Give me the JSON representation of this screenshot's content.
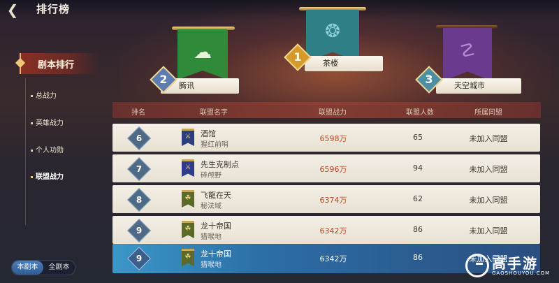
{
  "header": {
    "title": "排行榜",
    "back_icon": "back-arrow-icon"
  },
  "sidebar": {
    "main_label": "剧本排行",
    "items": [
      {
        "label": "总战力",
        "active": false
      },
      {
        "label": "英雄战力",
        "active": false
      },
      {
        "label": "个人功勋",
        "active": false
      },
      {
        "label": "联盟战力",
        "active": true
      }
    ]
  },
  "scope_toggle": {
    "current": "本剧本",
    "all": "全剧本"
  },
  "podium": [
    {
      "rank": "2",
      "name": "腾讯",
      "banner_color": "#2f8a3a",
      "medal_color": "#5b7db2"
    },
    {
      "rank": "1",
      "name": "茶楼",
      "banner_color": "#2f7f86",
      "medal_color": "#d59a2a"
    },
    {
      "rank": "3",
      "name": "天空城市",
      "banner_color": "#6a3a8e",
      "medal_color": "#4f8fa6"
    }
  ],
  "table": {
    "headers": [
      "排名",
      "联盟名字",
      "联盟战力",
      "联盟人数",
      "所属同盟"
    ],
    "rows": [
      {
        "rank": "6",
        "name": "酒馆",
        "leader": "猩红前哨",
        "power": "6598万",
        "members": "65",
        "alliance": "未加入同盟",
        "flag_color": "#2c3f7a"
      },
      {
        "rank": "7",
        "name": "先生克制点",
        "leader": "碎颅野",
        "power": "6596万",
        "members": "94",
        "alliance": "未加入同盟",
        "flag_color": "#2f3a8a"
      },
      {
        "rank": "8",
        "name": "飞龍在天",
        "leader": "秘法域",
        "power": "6374万",
        "members": "62",
        "alliance": "未加入同盟",
        "flag_color": "#5a6a2a"
      },
      {
        "rank": "9",
        "name": "龙十帝国",
        "leader": "猎喉地",
        "power": "6342万",
        "members": "86",
        "alliance": "未加入同盟",
        "flag_color": "#5a6a2a"
      }
    ],
    "self_row": {
      "rank": "9",
      "name": "龙十帝国",
      "leader": "猎喉地",
      "power": "6342万",
      "members": "86",
      "alliance": "未加入同盟",
      "flag_color": "#5a6a2a"
    }
  },
  "watermark": {
    "brand": "高手游",
    "domain": "GAOSHOUYOU.COM"
  }
}
